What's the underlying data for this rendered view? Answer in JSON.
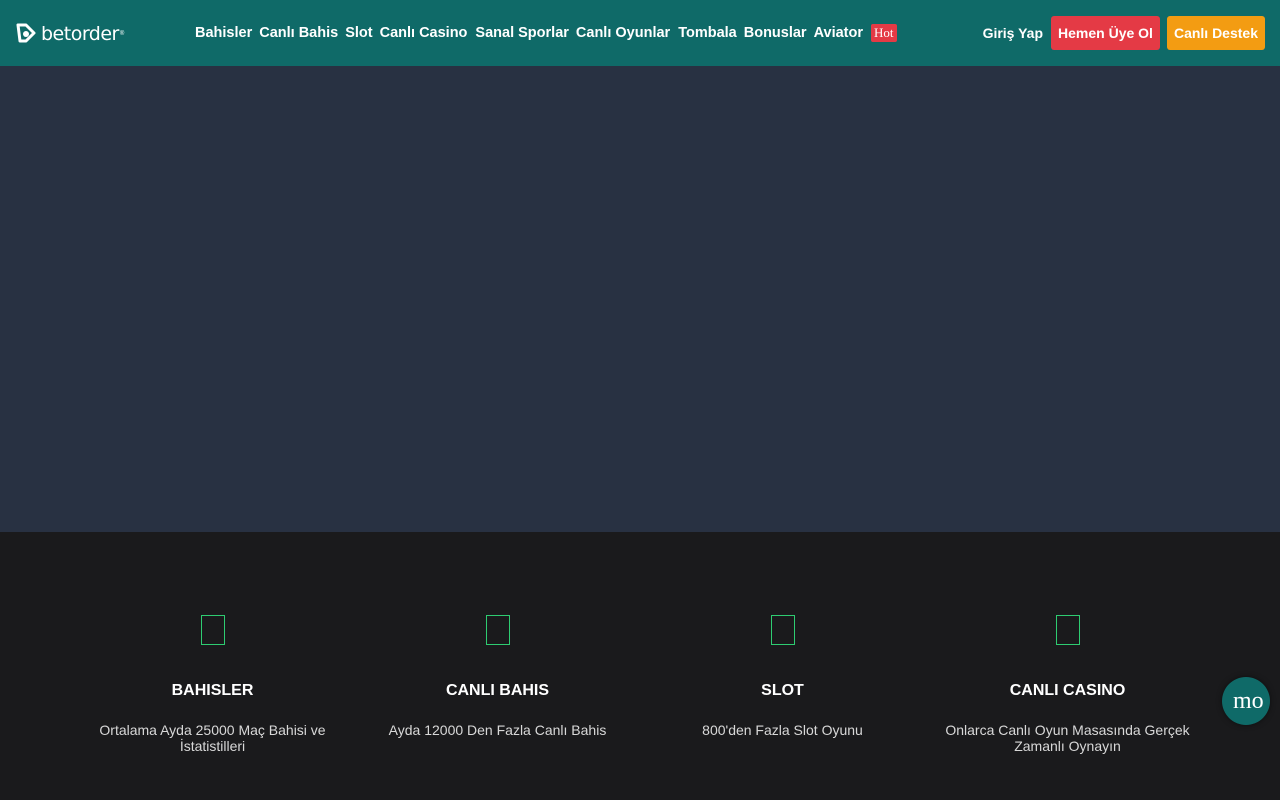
{
  "brand": {
    "name": "betorder",
    "mark": "®"
  },
  "nav": {
    "items": [
      {
        "label": "Bahisler"
      },
      {
        "label": "Canlı Bahis"
      },
      {
        "label": "Slot"
      },
      {
        "label": "Canlı Casino"
      },
      {
        "label": "Sanal Sporlar"
      },
      {
        "label": "Canlı Oyunlar"
      },
      {
        "label": "Tombala"
      },
      {
        "label": "Bonuslar"
      },
      {
        "label": "Aviator"
      }
    ],
    "hot_badge": "Hot"
  },
  "auth": {
    "login_label": "Giriş Yap",
    "register_label": "Hemen Üye Ol",
    "support_label": "Canlı Destek"
  },
  "features": [
    {
      "title": "BAHISLER",
      "desc": "Ortalama Ayda 25000 Maç Bahisi ve İstatistilleri"
    },
    {
      "title": "CANLI BAHIS",
      "desc": "Ayda 12000 Den Fazla Canlı Bahis"
    },
    {
      "title": "SLOT",
      "desc": "800'den Fazla Slot Oyunu"
    },
    {
      "title": "CANLI CASINO",
      "desc": "Onlarca Canlı Oyun Masasında Gerçek Zamanlı Oynayın"
    }
  ],
  "chat": {
    "label": "mo"
  },
  "colors": {
    "header": "#0f6a68",
    "hero": "#283142",
    "footer": "#1a1a1c",
    "register": "#e43a45",
    "support": "#f39c12",
    "icon_outline": "#2ecc71"
  }
}
